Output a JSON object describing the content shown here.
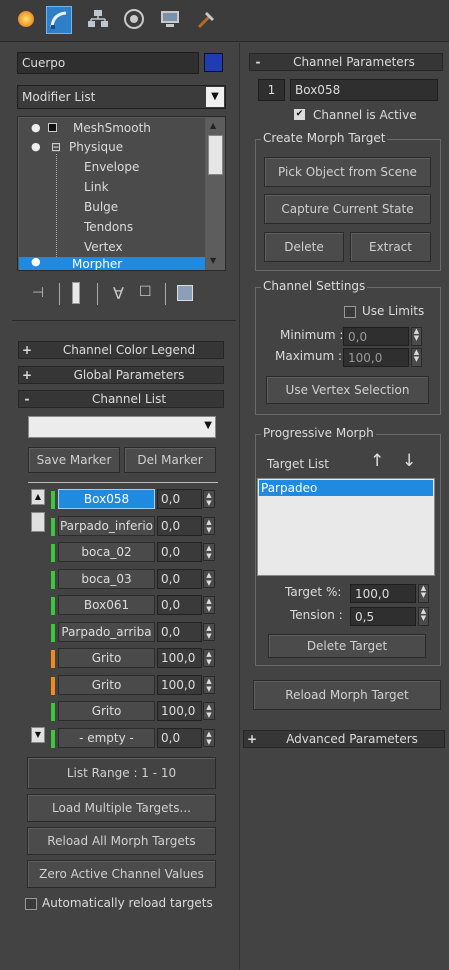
{
  "toolbar": {
    "tabs": [
      {
        "icon": "create-icon"
      },
      {
        "icon": "modify-icon"
      },
      {
        "icon": "hierarchy-icon"
      },
      {
        "icon": "motion-icon"
      },
      {
        "icon": "display-icon"
      },
      {
        "icon": "utilities-icon"
      }
    ]
  },
  "object": {
    "name": "Cuerpo",
    "color": "#1f3cb4"
  },
  "modifier_list": {
    "label": "Modifier List"
  },
  "stack": {
    "items": [
      {
        "label": "MeshSmooth"
      },
      {
        "label": "Physique"
      },
      {
        "label": "Envelope"
      },
      {
        "label": "Link"
      },
      {
        "label": "Bulge"
      },
      {
        "label": "Tendons"
      },
      {
        "label": "Vertex"
      },
      {
        "label": "Morpher"
      }
    ]
  },
  "left_rollouts": {
    "channel_color_legend": "Channel Color Legend",
    "global_parameters": "Global Parameters",
    "channel_list": "Channel List"
  },
  "channel_list": {
    "save_marker": "Save Marker",
    "del_marker": "Del Marker",
    "channels": [
      {
        "name": "Box058",
        "value": "0,0",
        "color": "#3cc83c"
      },
      {
        "name": "Parpado_inferio",
        "value": "0,0",
        "color": "#3cc83c"
      },
      {
        "name": "boca_02",
        "value": "0,0",
        "color": "#3cc83c"
      },
      {
        "name": "boca_03",
        "value": "0,0",
        "color": "#3cc83c"
      },
      {
        "name": "Box061",
        "value": "0,0",
        "color": "#3cc83c"
      },
      {
        "name": "Parpado_arriba",
        "value": "0,0",
        "color": "#3cc83c"
      },
      {
        "name": "Grito",
        "value": "100,0",
        "color": "#f08c1e"
      },
      {
        "name": "Grito",
        "value": "100,0",
        "color": "#f08c1e"
      },
      {
        "name": "Grito",
        "value": "100,0",
        "color": "#3cc83c"
      },
      {
        "name": "- empty -",
        "value": "0,0",
        "color": "#3cc83c"
      }
    ],
    "list_range": "List Range :   1 - 10",
    "load_multiple": "Load Multiple Targets...",
    "reload_all": "Reload All Morph Targets",
    "zero_active": "Zero Active Channel Values",
    "auto_reload": "Automatically reload targets"
  },
  "channel_parameters": {
    "title": "Channel Parameters",
    "index": "1",
    "name": "Box058",
    "is_active_label": "Channel is Active",
    "create_morph_target": "Create Morph Target",
    "pick_object": "Pick Object from Scene",
    "capture_state": "Capture Current State",
    "delete": "Delete",
    "extract": "Extract",
    "channel_settings": "Channel Settings",
    "use_limits": "Use Limits",
    "minimum_label": "Minimum :",
    "minimum_value": "0,0",
    "maximum_label": "Maximum :",
    "maximum_value": "100,0",
    "use_vertex_selection": "Use Vertex Selection",
    "progressive_morph": "Progressive Morph",
    "target_list": "Target List",
    "targets": [
      "Parpadeo"
    ],
    "target_pct_label": "Target %:",
    "target_pct_value": "100,0",
    "tension_label": "Tension :",
    "tension_value": "0,5",
    "delete_target": "Delete Target",
    "reload_morph_target": "Reload Morph Target"
  },
  "advanced_parameters": "Advanced Parameters"
}
